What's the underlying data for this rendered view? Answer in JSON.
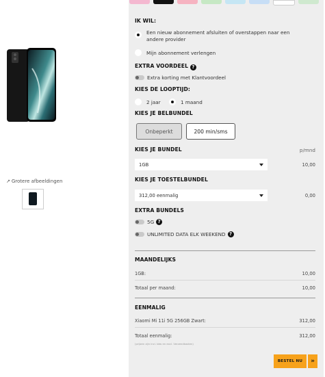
{
  "product": {
    "larger_images_label": "Grotere afbeeldingen",
    "external_icon": "external-link-icon"
  },
  "colors": {
    "panel_bg": "#eeeeee",
    "accent_order": "#f7a21b",
    "swatches": [
      "#f4b8d0",
      "#111111",
      "#f6b3c1",
      "#c6e8c4",
      "#c5e6f4",
      "#c7def6",
      "#ffffff",
      "#cfe9cf"
    ]
  },
  "wil": {
    "title": "IK WIL:",
    "options": [
      {
        "label": "Een nieuw abonnement afsluiten of overstappen naar een andere provider",
        "selected": true
      },
      {
        "label": "Mijn abonnement verlengen",
        "selected": false
      }
    ]
  },
  "extra": {
    "title": "EXTRA VOORDEEL",
    "toggle_label": "Extra korting met Klantvoordeel"
  },
  "looptijd": {
    "title": "KIES DE LOOPTIJD:",
    "options": [
      {
        "label": "2 jaar",
        "selected": false
      },
      {
        "label": "1 maand",
        "selected": true
      }
    ]
  },
  "belbundel": {
    "title": "KIES JE BELBUNDEL",
    "options": [
      {
        "label": "Onbeperkt",
        "active": true
      },
      {
        "label": "200 min/sms",
        "active": false
      }
    ]
  },
  "bundel": {
    "title": "KIES JE BUNDEL",
    "unit": "p/mnd",
    "selected": "1GB",
    "price": "10,00"
  },
  "toestel": {
    "title": "KIES JE TOESTELBUNDEL",
    "selected": "312,00 eenmalig",
    "price": "0,00"
  },
  "extra_bundels": {
    "title": "EXTRA BUNDELS",
    "items": [
      {
        "label": "5G"
      },
      {
        "label": "UNLIMITED DATA ELK WEEKEND"
      }
    ]
  },
  "maandelijks": {
    "title": "MAANDELIJKS",
    "rows": [
      {
        "label": "1GB:",
        "value": "10,00"
      },
      {
        "label": "Totaal per maand:",
        "value": "10,00"
      }
    ]
  },
  "eenmalig": {
    "title": "EENMALIG",
    "rows": [
      {
        "label": "Xiaomi Mi 11i 5G 256GB Zwart:",
        "value": "312,00"
      },
      {
        "label": "Totaal eenmalig:",
        "value": "312,00"
      }
    ],
    "note": "(prijzen zijn incl. btw en excl. Verzendkosten)"
  },
  "order": {
    "button_label": "BESTEL NU",
    "arrow": "»"
  }
}
